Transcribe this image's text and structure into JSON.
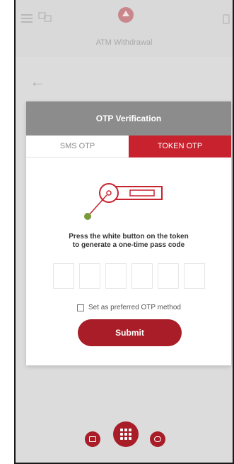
{
  "header": {
    "title": "ATM Withdrawal",
    "menu_icon": "hamburger-icon",
    "language_icon": "translate-icon",
    "logo_icon": "bank-logo-icon"
  },
  "navigation": {
    "back_icon": "back-arrow-icon",
    "back_glyph": "←"
  },
  "modal": {
    "title": "OTP Verification",
    "tabs": [
      {
        "label": "SMS OTP",
        "active": false
      },
      {
        "label": "TOKEN OTP",
        "active": true
      }
    ],
    "instruction_line1": "Press the white button on the token",
    "instruction_line2": "to generate a one-time pass code",
    "otp_length": 6,
    "preferred_label": "Set as preferred OTP method",
    "preferred_checked": false,
    "submit_label": "Submit"
  },
  "bottom_nav": {
    "items": [
      {
        "icon": "wallet-icon"
      },
      {
        "icon": "grid-menu-icon"
      },
      {
        "icon": "inbox-icon"
      }
    ]
  },
  "colors": {
    "accent": "#c8222e",
    "button": "#a81d27",
    "header_gray": "#8c8c8c",
    "illustration": "#c8222e",
    "token_dot": "#7a9a3a"
  }
}
